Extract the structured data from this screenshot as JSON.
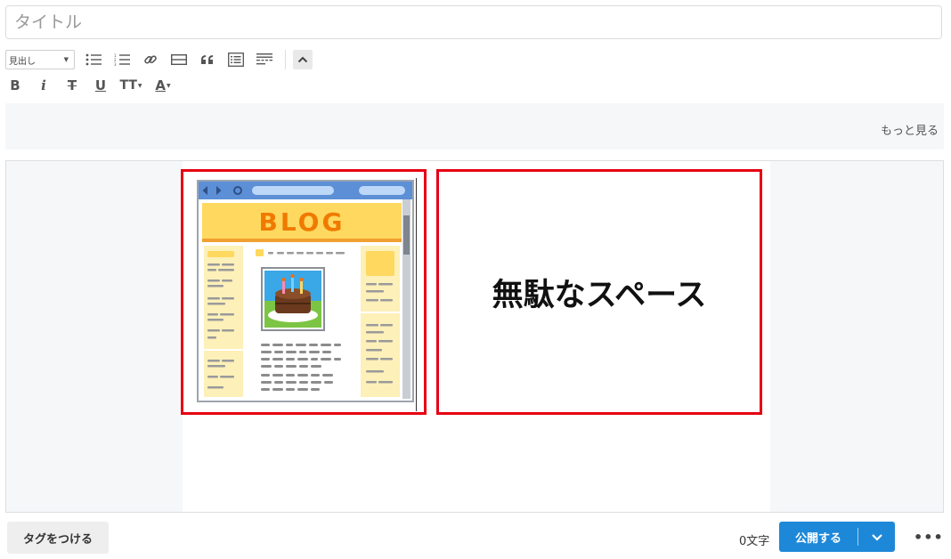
{
  "title": {
    "placeholder": "タイトル"
  },
  "toolbar": {
    "heading_select": "見出し",
    "icons_row1": [
      "bulleted-list-icon",
      "numbered-list-icon",
      "link-icon",
      "horizontal-rule-icon",
      "quote-icon",
      "table-of-contents-icon",
      "more-separator-icon",
      "chevron-up-icon"
    ],
    "icons_row2": [
      "bold-icon",
      "italic-icon",
      "strikethrough-icon",
      "underline-icon",
      "text-size-icon",
      "text-color-icon"
    ],
    "bold": "B",
    "italic": "i",
    "strike": "T",
    "underline": "U",
    "text_size": "TT",
    "text_color": "A"
  },
  "more_panel": {
    "link": "もっと見る"
  },
  "editor": {
    "image_text": "BLOG",
    "wasted_space_label": "無駄なスペース",
    "colors": {
      "frame": "#e60012",
      "banner": "#ffd860",
      "banner_text": "#f07a00"
    }
  },
  "footer": {
    "tag_button": "タグをつける",
    "char_count": "0文字",
    "publish_button": "公開する",
    "more_icon": "ellipsis-icon"
  },
  "colors": {
    "accent": "#1e88d8"
  }
}
